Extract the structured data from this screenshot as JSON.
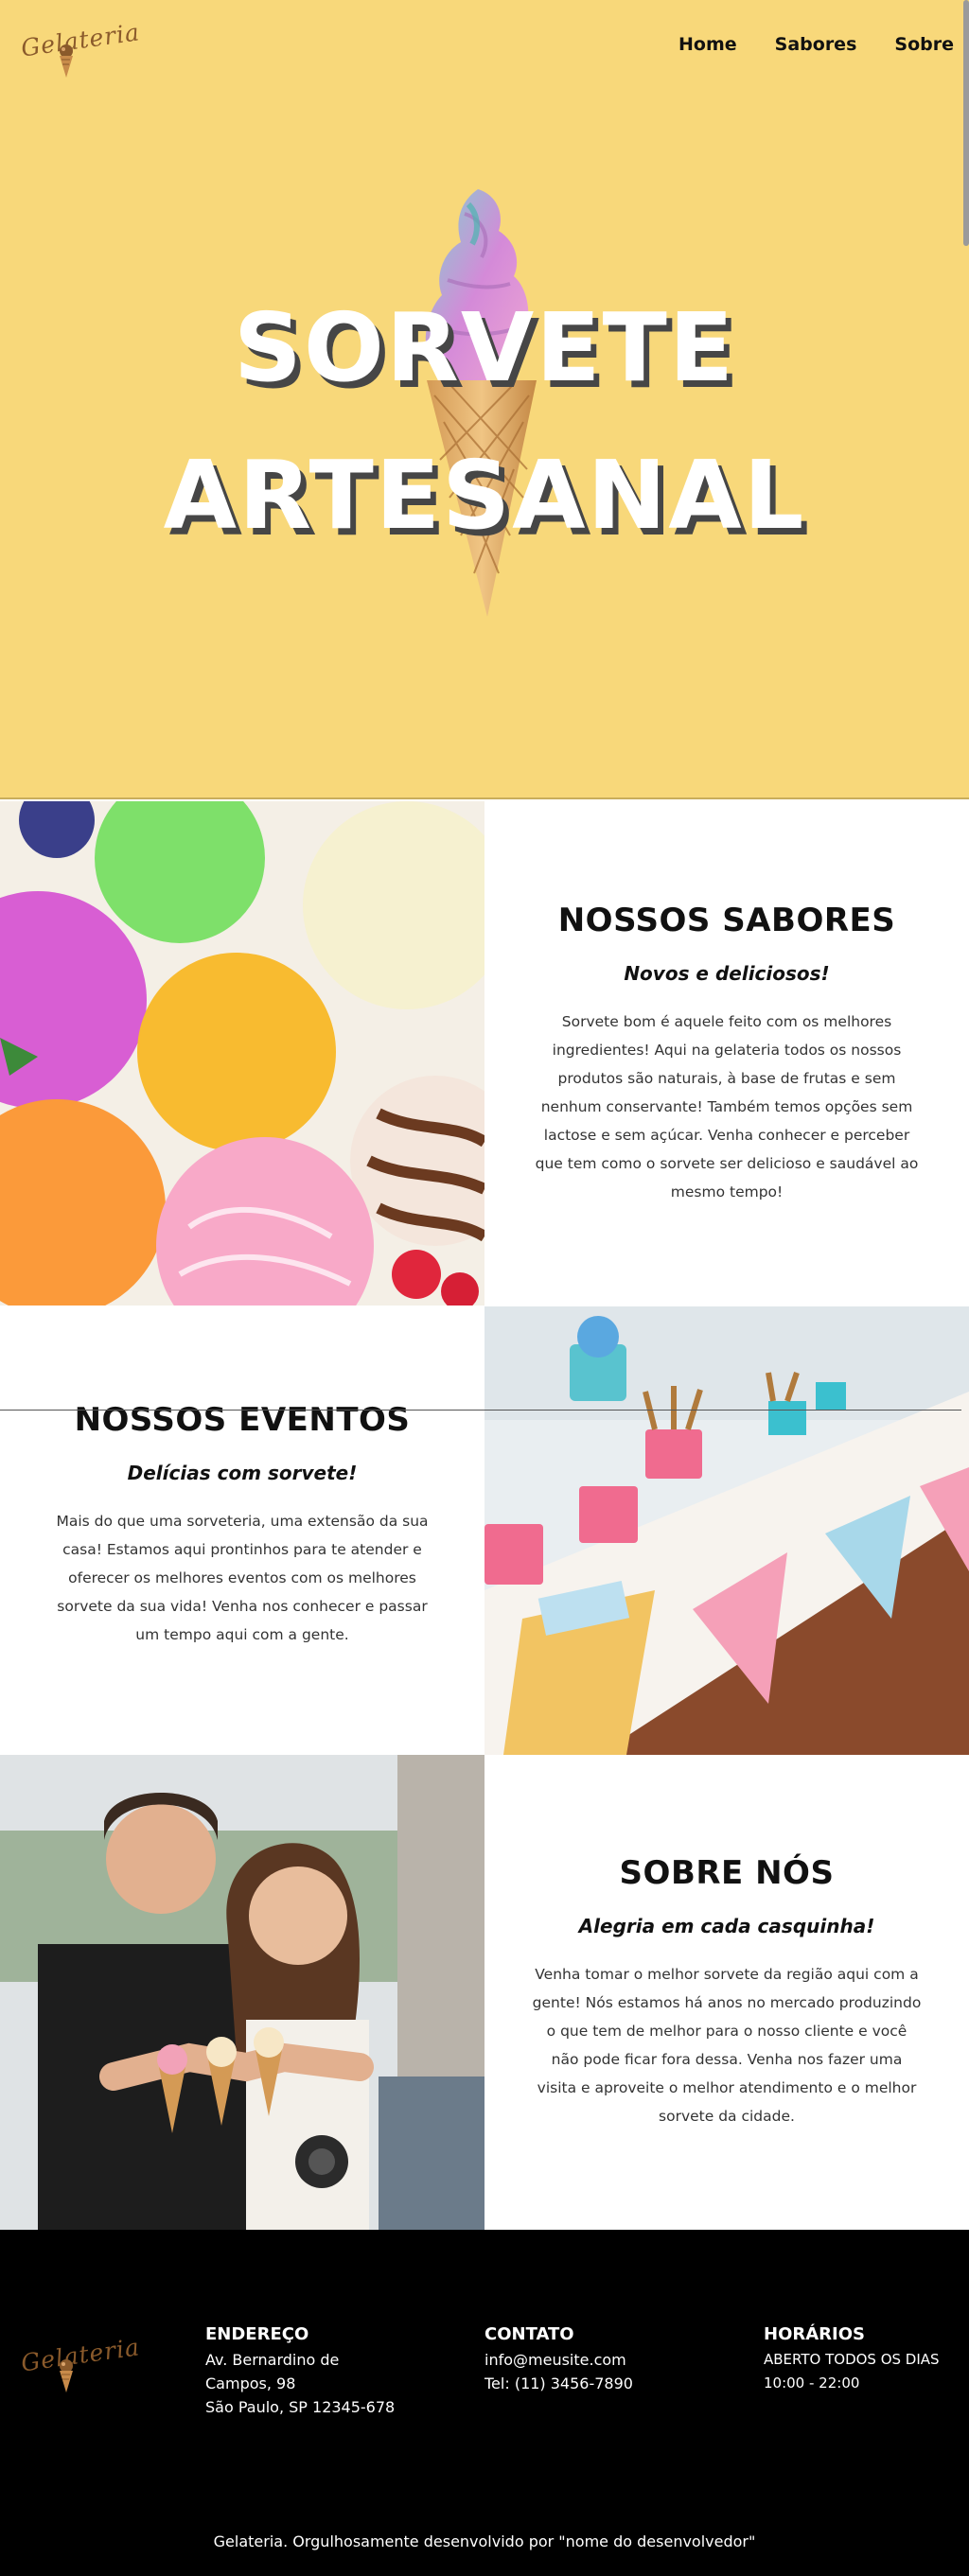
{
  "brand": {
    "logo_text": "Gelateria"
  },
  "nav": {
    "items": [
      {
        "label": "Home"
      },
      {
        "label": "Sabores"
      },
      {
        "label": "Sobre"
      }
    ]
  },
  "hero": {
    "title_line1": "SORVETE",
    "title_line2": "ARTESANAL"
  },
  "sections": {
    "sabores": {
      "title": "NOSSOS SABORES",
      "subtitle": "Novos e deliciosos!",
      "body": "Sorvete bom é aquele feito com os melhores ingredientes! Aqui na gelateria todos os nossos produtos são naturais, à base de frutas e sem nenhum conservante! Também temos opções sem lactose e sem açúcar. Venha conhecer e perceber que tem como o sorvete ser delicioso e saudável ao mesmo tempo!"
    },
    "eventos": {
      "title": "NOSSOS EVENTOS",
      "subtitle": "Delícias com sorvete!",
      "body": "Mais do que uma sorveteria, uma extensão da sua casa! Estamos aqui prontinhos para te atender e oferecer os melhores eventos com os melhores sorvete da sua vida! Venha nos conhecer e passar um tempo aqui com a gente."
    },
    "sobre": {
      "title": "SOBRE NÓS",
      "subtitle": "Alegria em cada casquinha!",
      "body": "Venha tomar o melhor sorvete da região aqui com a gente! Nós estamos há anos no mercado produzindo o que tem de melhor para o nosso cliente e você não pode ficar fora dessa. Venha nos fazer uma visita e aproveite o melhor atendimento e o melhor sorvete da cidade."
    }
  },
  "footer": {
    "endereco": {
      "heading": "ENDEREÇO",
      "line1": "Av. Bernardino de",
      "line2": "Campos, 98",
      "line3": "São Paulo, SP 12345-678"
    },
    "contato": {
      "heading": "CONTATO",
      "email": "info@meusite.com",
      "phone": "Tel: (11) 3456-7890"
    },
    "horarios": {
      "heading": "HORÁRIOS",
      "line1": "ABERTO TODOS OS DIAS",
      "line2": "10:00 - 22:00"
    },
    "copyright": "Gelateria. Orgulhosamente desenvolvido por \"nome do desenvolvedor\""
  },
  "colors": {
    "hero_bg": "#f8d87a",
    "footer_bg": "#000000",
    "brand_brown": "#8a5a2b"
  },
  "icons": {
    "logo_cone": "ice-cream-cone-icon"
  }
}
